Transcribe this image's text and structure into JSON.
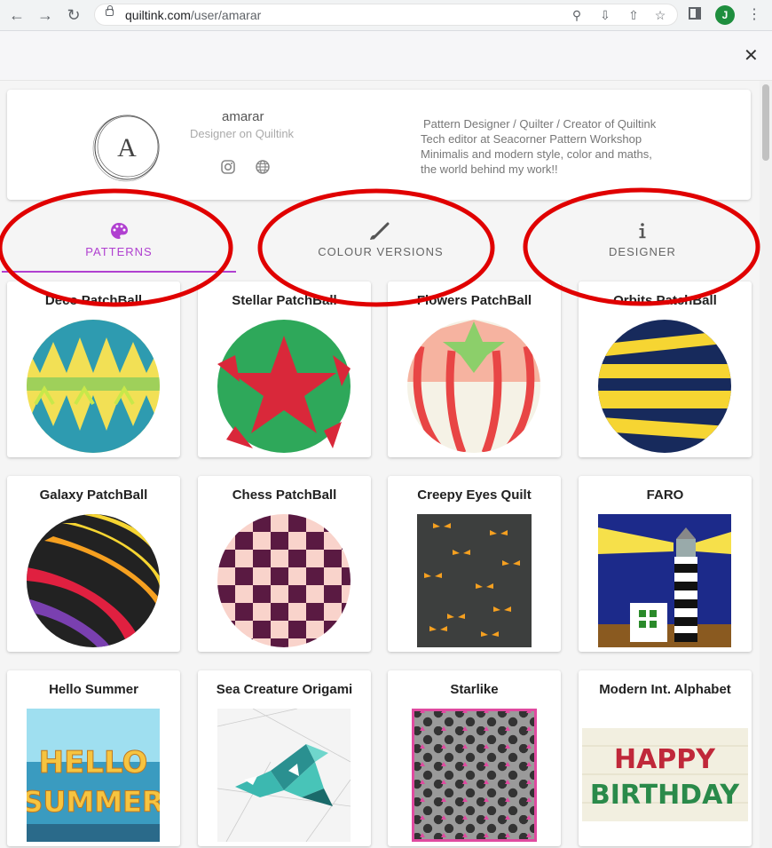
{
  "browser": {
    "url_domain": "quiltink.com",
    "url_path": "/user/amarar",
    "profile_initial": "J"
  },
  "profile": {
    "username": "amarar",
    "role": "Designer on Quiltink",
    "bio_lines": [
      "Pattern Designer / Quilter / Creator of Quiltink",
      "Tech editor at Seacorner Pattern Workshop",
      "Minimalis and modern style, color and maths,",
      "the world behind my work!!"
    ]
  },
  "tabs": [
    {
      "label": "PATTERNS",
      "icon": "palette-icon",
      "active": true
    },
    {
      "label": "COLOUR VERSIONS",
      "icon": "brush-icon",
      "active": false
    },
    {
      "label": "DESIGNER",
      "icon": "info-icon",
      "active": false
    }
  ],
  "patterns": [
    {
      "title": "Deco PatchBall"
    },
    {
      "title": "Stellar PatchBall"
    },
    {
      "title": "Flowers PatchBall"
    },
    {
      "title": "Orbits PatchBall"
    },
    {
      "title": "Galaxy PatchBall"
    },
    {
      "title": "Chess PatchBall"
    },
    {
      "title": "Creepy Eyes Quilt"
    },
    {
      "title": "FARO"
    },
    {
      "title": "Hello Summer",
      "art_text": [
        "HELLO",
        "SUMMER"
      ]
    },
    {
      "title": "Sea Creature Origami"
    },
    {
      "title": "Starlike"
    },
    {
      "title": "Modern Int. Alphabet",
      "art_text": [
        "HAPPY",
        "BIRTHDAY"
      ]
    }
  ],
  "colors": {
    "accent": "#b040d0",
    "annotation": "#e00000"
  }
}
